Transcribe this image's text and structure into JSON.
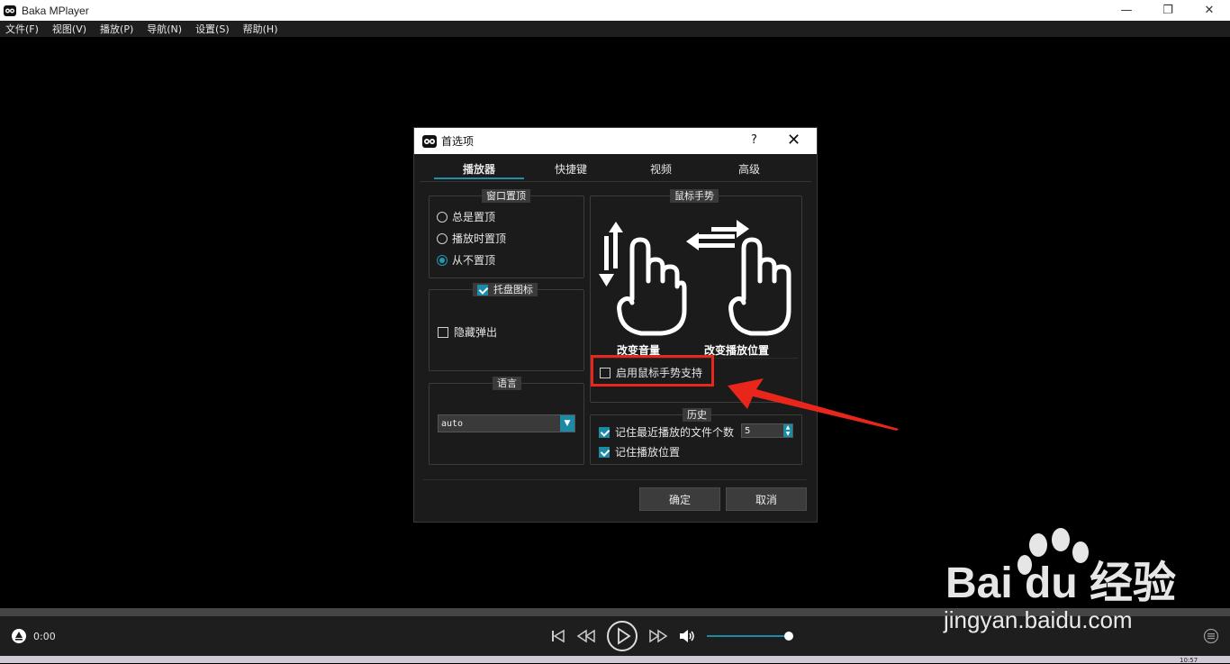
{
  "window": {
    "title": "Baka MPlayer",
    "minimize_glyph": "—",
    "restore_glyph": "❐",
    "close_glyph": "✕"
  },
  "menu": [
    "文件(F)",
    "视图(V)",
    "播放(P)",
    "导航(N)",
    "设置(S)",
    "帮助(H)"
  ],
  "dialog": {
    "title": "首选项",
    "help_label": "?",
    "close_label": "✕",
    "tabs": [
      {
        "label": "播放器",
        "active": true
      },
      {
        "label": "快捷键",
        "active": false
      },
      {
        "label": "视频",
        "active": false
      },
      {
        "label": "高级",
        "active": false
      }
    ],
    "ontop": {
      "title": "窗口置顶",
      "options": [
        {
          "label": "总是置顶",
          "checked": false
        },
        {
          "label": "播放时置顶",
          "checked": false
        },
        {
          "label": "从不置顶",
          "checked": true
        }
      ]
    },
    "tray": {
      "title": "托盘图标",
      "enabled": true,
      "hide_popup_label": "隐藏弹出",
      "hide_popup_checked": false
    },
    "language": {
      "title": "语言",
      "value": "auto"
    },
    "gestures": {
      "title": "鼠标手势",
      "volume_label": "改变音量",
      "seek_label": "改变播放位置",
      "enable_label": "启用鼠标手势支持",
      "enable_checked": false
    },
    "history": {
      "title": "历史",
      "recent_label": "记住最近播放的文件个数",
      "recent_checked": true,
      "recent_count": "5",
      "position_label": "记住播放位置",
      "position_checked": true
    },
    "ok_label": "确定",
    "cancel_label": "取消"
  },
  "player": {
    "time": "0:00",
    "volume_level": 0.95
  },
  "taskbar": {
    "clock": "10:57"
  },
  "watermark": {
    "brand": "Bai du 经验",
    "url": "jingyan.baidu.com"
  },
  "colors": {
    "accent": "#1b8aa4",
    "highlight": "#e8261b"
  }
}
